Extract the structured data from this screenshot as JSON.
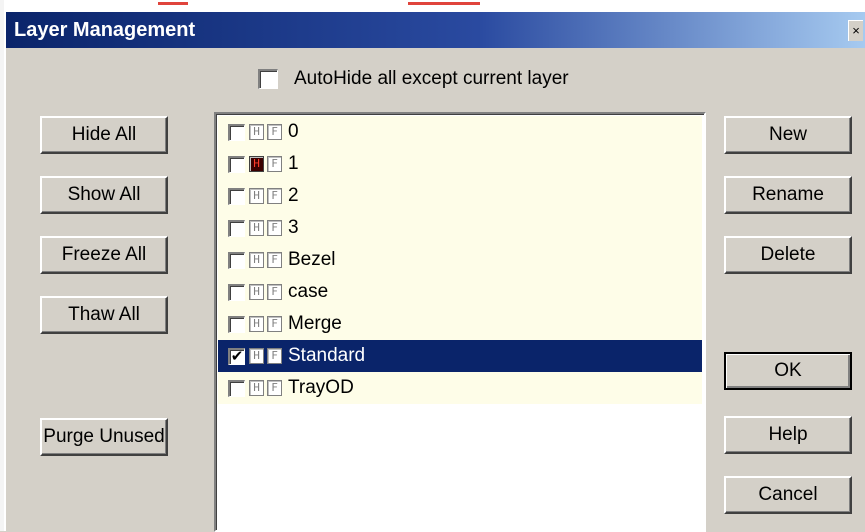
{
  "dialog": {
    "title": "Layer Management",
    "close_glyph": "×"
  },
  "autohide": {
    "label": "AutoHide all except current layer",
    "checked": false
  },
  "left_buttons": {
    "hide_all": "Hide All",
    "show_all": "Show All",
    "freeze_all": "Freeze All",
    "thaw_all": "Thaw All",
    "purge_unused": "Purge Unused"
  },
  "right_buttons": {
    "new": "New",
    "rename": "Rename",
    "delete": "Delete",
    "ok": "OK",
    "help": "Help",
    "cancel": "Cancel"
  },
  "flag_labels": {
    "hide": "H",
    "freeze": "F"
  },
  "layers": [
    {
      "name": "0",
      "current": false,
      "hidden": false,
      "frozen": false
    },
    {
      "name": "1",
      "current": false,
      "hidden": true,
      "frozen": false
    },
    {
      "name": "2",
      "current": false,
      "hidden": false,
      "frozen": false
    },
    {
      "name": "3",
      "current": false,
      "hidden": false,
      "frozen": false
    },
    {
      "name": "Bezel",
      "current": false,
      "hidden": false,
      "frozen": false
    },
    {
      "name": "case",
      "current": false,
      "hidden": false,
      "frozen": false
    },
    {
      "name": "Merge",
      "current": false,
      "hidden": false,
      "frozen": false
    },
    {
      "name": "Standard",
      "current": true,
      "hidden": false,
      "frozen": false
    },
    {
      "name": "TrayOD",
      "current": false,
      "hidden": false,
      "frozen": false
    }
  ],
  "selected_layer": "Standard",
  "colors": {
    "title_bar": "#0a246a",
    "selection": "#0a246a",
    "list_row_bg": "#fefde8",
    "hidden_flag": "#ff3b2b"
  }
}
